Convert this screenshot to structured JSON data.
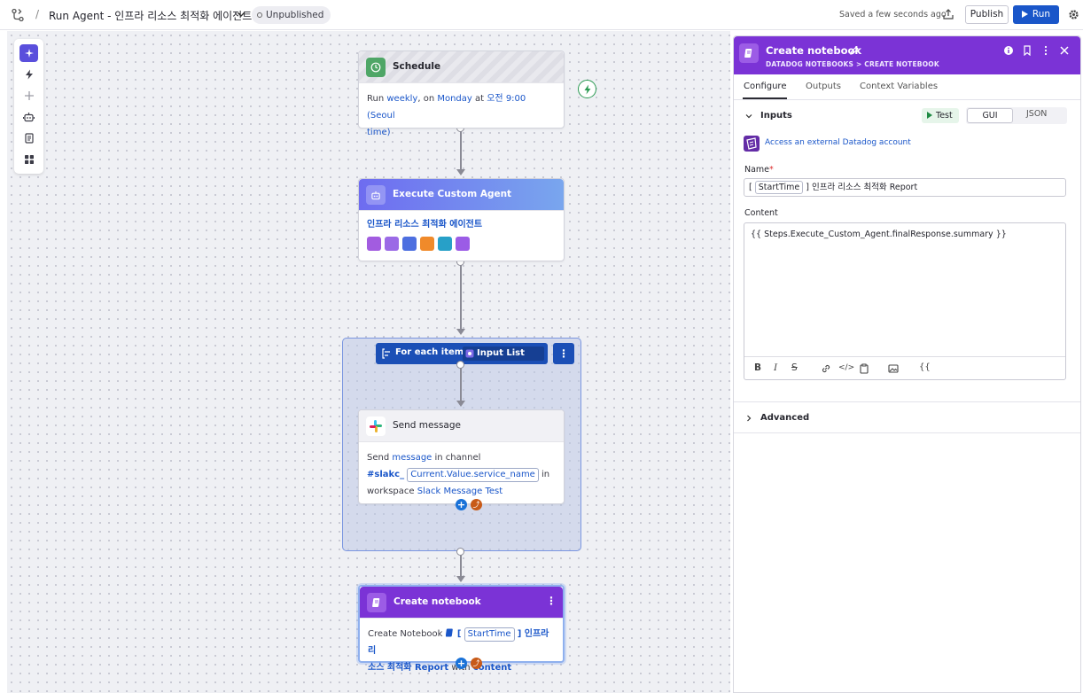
{
  "topbar": {
    "separator": "/",
    "title": "Run Agent - 인프라 리소스 최적화 에이전트",
    "status": "Unpublished",
    "saved": "Saved a few seconds ago",
    "publish": "Publish",
    "run": "Run"
  },
  "nodes": {
    "schedule": {
      "title": "Schedule",
      "t1": "Run ",
      "frequency": "weekly",
      "t2": ", on ",
      "day": "Monday",
      "t3": " at ",
      "time": "오전 9:00 (Seoul",
      "time2": "time)",
      "t4": ""
    },
    "agent": {
      "title": "Execute Custom Agent",
      "agent_name": "인프라 리소스 최적화 에이전트",
      "icon_colors": [
        "#a25ce0",
        "#9b6ae6",
        "#4d6fe0",
        "#f08a2a",
        "#27a0c8",
        "#9b5ce6"
      ]
    },
    "loop": {
      "label": "For each item in",
      "list": "Input List"
    },
    "slack": {
      "title": "Send message",
      "t1": "Send ",
      "message": "message",
      "t2": " in channel",
      "channel_prefix": "#slakc_",
      "channel_var": "Current.Value.service_name",
      "t3": " in",
      "t4": "workspace ",
      "workspace": "Slack Message Test"
    },
    "notebook": {
      "title": "Create notebook",
      "t1": "Create Notebook ",
      "bracket_open": "[",
      "var": "StartTime",
      "name_rest": "] 인프라 리",
      "name_rest2": "소스 최적화 Report",
      "t2": " with ",
      "content": "content"
    }
  },
  "panel": {
    "title": "Create notebook",
    "breadcrumb": "DATADOG NOTEBOOKS > CREATE NOTEBOOK",
    "tabs": [
      "Configure",
      "Outputs",
      "Context Variables"
    ],
    "inputs_label": "Inputs",
    "test": "Test",
    "gui": "GUI",
    "json": "JSON",
    "external_account": "Access an external Datadog account",
    "name_label": "Name",
    "required": "*",
    "name_value_open": "[",
    "name_var": "StartTime",
    "name_value_rest": "] 인프라 리소스 최적화 Report",
    "content_label": "Content",
    "content_value": "{{ Steps.Execute_Custom_Agent.finalResponse.summary }}",
    "tools": {
      "bold": "B",
      "italic": "I",
      "strike": "S",
      "code": "</>",
      "template": "{{"
    },
    "advanced": "Advanced"
  },
  "colors": {
    "accent_purple": "#7b33d6",
    "run_blue": "#1a56c9",
    "loop_blue": "#1b4fb6"
  }
}
